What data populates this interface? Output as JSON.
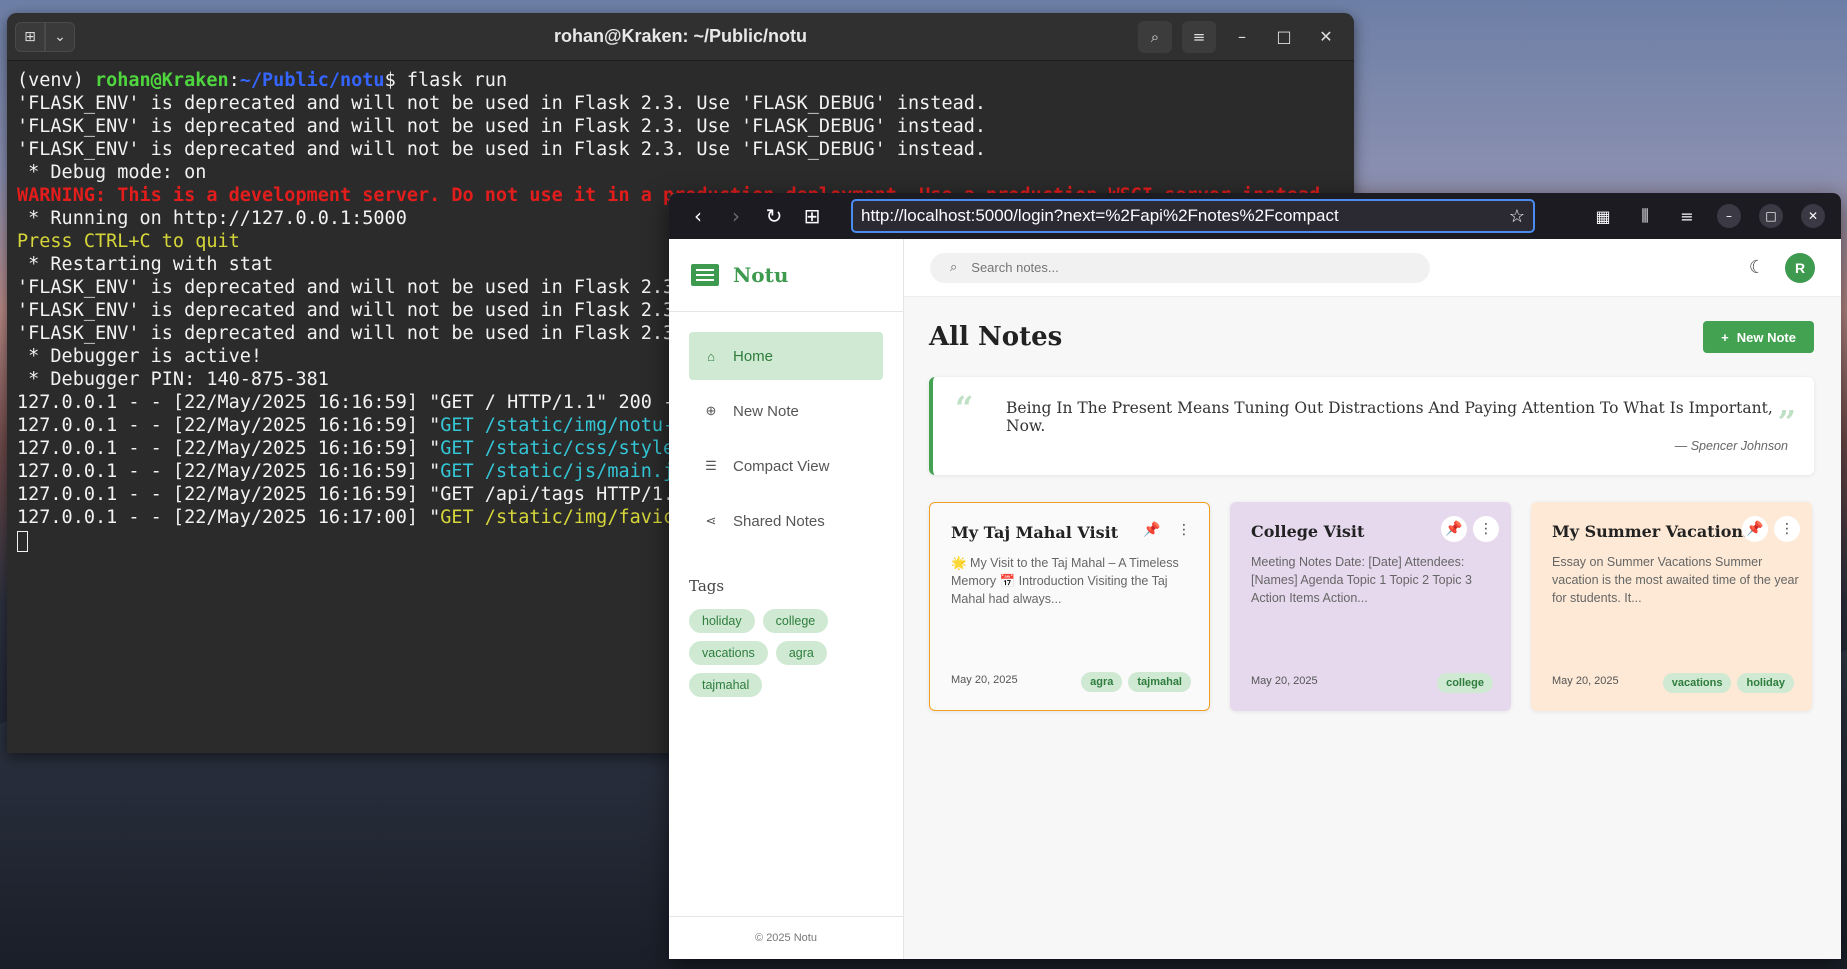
{
  "terminal": {
    "title": "rohan@Kraken: ~/Public/notu",
    "prompt_venv": "(venv) ",
    "prompt_user": "rohan@Kraken",
    "prompt_sep": ":",
    "prompt_path": "~/Public/notu",
    "prompt_end": "$ ",
    "command": "flask run",
    "lines": {
      "l1": "'FLASK_ENV' is deprecated and will not be used in Flask 2.3. Use 'FLASK_DEBUG' instead.",
      "l2": "'FLASK_ENV' is deprecated and will not be used in Flask 2.3. Use 'FLASK_DEBUG' instead.",
      "l3": "'FLASK_ENV' is deprecated and will not be used in Flask 2.3. Use 'FLASK_DEBUG' instead.",
      "l4": " * Debug mode: on",
      "l5": "WARNING: This is a development server. Do not use it in a production deployment. Use a production WSGI server instead.",
      "l6": " * Running on http://127.0.0.1:5000",
      "l7": "Press CTRL+C to quit",
      "l8": " * Restarting with stat",
      "l9": "'FLASK_ENV' is deprecated and will not be used in Flask 2.3.",
      "l10": "'FLASK_ENV' is deprecated and will not be used in Flask 2.3.",
      "l11": "'FLASK_ENV' is deprecated and will not be used in Flask 2.3.",
      "l12": " * Debugger is active!",
      "l13": " * Debugger PIN: 140-875-381",
      "l14a": "127.0.0.1 - - [22/May/2025 16:16:59] \"GET / HTTP/1.1\" 200 -",
      "l15a": "127.0.0.1 - - [22/May/2025 16:16:59] \"",
      "l15b": "GET /static/img/notu-l",
      "l16a": "127.0.0.1 - - [22/May/2025 16:16:59] \"",
      "l16b": "GET /static/css/style.",
      "l17a": "127.0.0.1 - - [22/May/2025 16:16:59] \"",
      "l17b": "GET /static/js/main.js",
      "l18a": "127.0.0.1 - - [22/May/2025 16:16:59] \"GET /api/tags HTTP/1.1",
      "l19a": "127.0.0.1 - - [22/May/2025 16:17:00] \"",
      "l19b": "GET /static/img/favico"
    }
  },
  "browser": {
    "url": "http://localhost:5000/login?next=%2Fapi%2Fnotes%2Fcompact"
  },
  "app": {
    "brand": "Notu",
    "nav": {
      "home": "Home",
      "new_note": "New Note",
      "compact_view": "Compact View",
      "shared_notes": "Shared Notes"
    },
    "tags_title": "Tags",
    "tags": [
      "holiday",
      "college",
      "vacations",
      "agra",
      "tajmahal"
    ],
    "footer": "© 2025 Notu",
    "search_placeholder": "Search notes...",
    "avatar_letter": "R",
    "page_title": "All Notes",
    "new_note_button": "New Note",
    "quote": {
      "text": "Being In The Present Means Tuning Out Distractions And Paying Attention To What Is Important, Now.",
      "author": "— Spencer Johnson"
    },
    "notes": [
      {
        "title": "My Taj Mahal Visit",
        "excerpt": "🌟 My Visit to the Taj Mahal – A Timeless Memory 📅 Introduction Visiting the Taj Mahal had always...",
        "date": "May 20, 2025",
        "tags": [
          "agra",
          "tajmahal"
        ]
      },
      {
        "title": "College Visit",
        "excerpt": "Meeting Notes Date: [Date] Attendees: [Names] Agenda Topic 1 Topic 2 Topic 3 Action Items Action...",
        "date": "May 20, 2025",
        "tags": [
          "college"
        ]
      },
      {
        "title": "My Summer Vacations",
        "excerpt": "Essay on Summer Vacations Summer vacation is the most awaited time of the year for students. It...",
        "date": "May 20, 2025",
        "tags": [
          "vacations",
          "holiday"
        ]
      }
    ]
  },
  "colors": {
    "accent_green": "#43a152",
    "terminal_bg": "#2b2b2b",
    "browser_toolbar": "#1c1b22"
  }
}
